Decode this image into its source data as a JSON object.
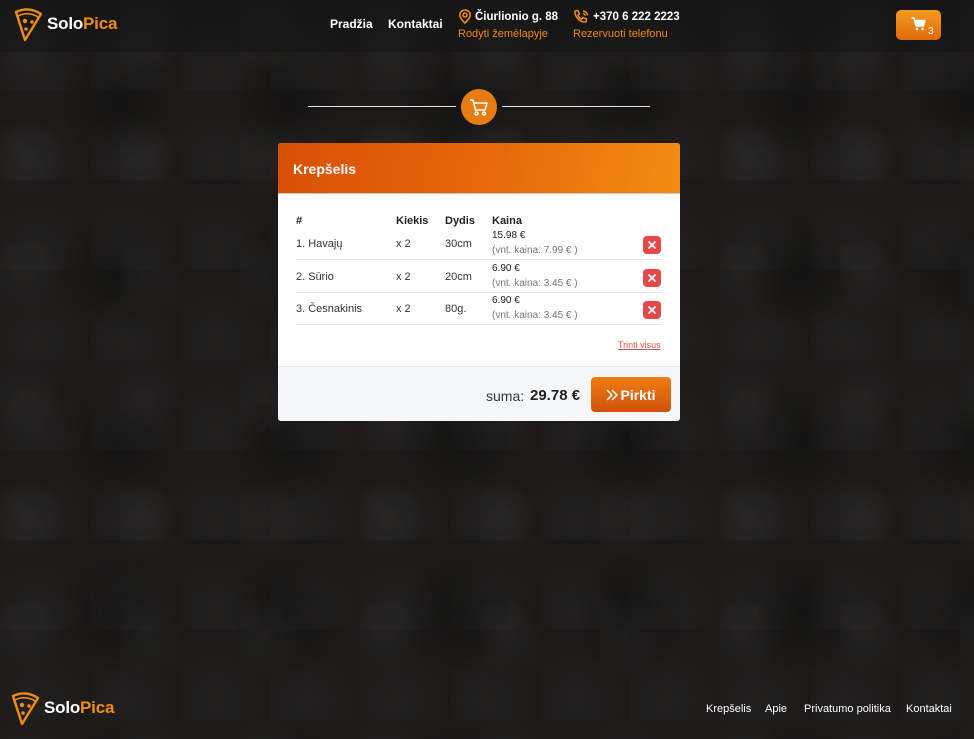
{
  "brand": {
    "name_part1": "Solo",
    "name_part2": "Pica",
    "accent_color": "#f08c14"
  },
  "nav": {
    "home_label": "Pradžia",
    "contacts_label": "Kontaktai",
    "address": "Čiurlionio g. 88",
    "address_link": "Rodyti žemėlapyje",
    "phone": "+370 6 222 2223",
    "phone_link": "Rezervuoti telefonu",
    "cart_count": "3",
    "icons": [
      "map-pin-icon",
      "phone-icon",
      "cart-icon"
    ]
  },
  "cart": {
    "title": "Krepšelis",
    "columns": [
      "#",
      "Kiekis",
      "Dydis",
      "Kaina"
    ],
    "items": [
      {
        "name": "1. Havajų",
        "qty": "x 2",
        "size": "30cm",
        "price": "15.98 €",
        "unit": "(vnt. kaina: 7.99 € )"
      },
      {
        "name": "2. Sūrio",
        "qty": "x 2",
        "size": "20cm",
        "price": "6.90 €",
        "unit": "(vnt. kaina: 3.45 € )"
      },
      {
        "name": "3. Česnakinis",
        "qty": "x 2",
        "size": "80g.",
        "price": "6.90 €",
        "unit": "(vnt. kaina: 3.45 € )"
      }
    ],
    "clear_all_label": "Trinti visus",
    "sum_label": "suma:",
    "sum_value": "29.78 €",
    "buy_label": "Pirkti"
  },
  "footer": {
    "links": [
      "Krepšelis",
      "Apie",
      "Privatumo politika",
      "Kontaktai"
    ]
  }
}
